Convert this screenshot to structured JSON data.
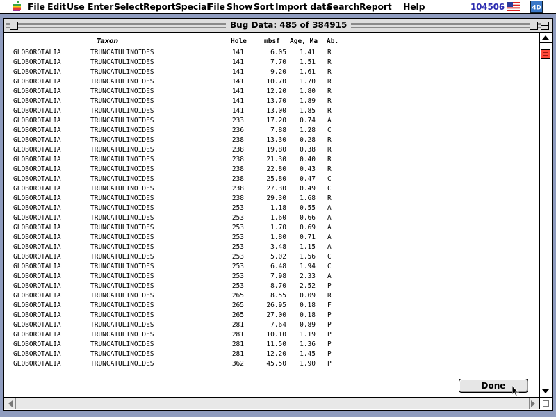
{
  "menubar": {
    "items": [
      "File",
      "Edit",
      "Use",
      "Enter",
      "Select",
      "Report",
      "Special",
      "File",
      "Show",
      "Sort",
      "Import data",
      "Search",
      "Report",
      "Help"
    ],
    "user_id": "104506",
    "icons": [
      "apple-icon",
      "flag-icon",
      "app-icon"
    ]
  },
  "window": {
    "title": "Bug Data: 485 of 384915"
  },
  "table": {
    "headers": {
      "taxon": "Taxon",
      "hole": "Hole",
      "mbsf": "mbsf",
      "age": "Age, Ma",
      "ab": "Ab."
    },
    "rows": [
      {
        "genus": "GLOBOROTALIA",
        "species": "TRUNCATULINOIDES",
        "hole": "141",
        "mbsf": "6.05",
        "age": "1.41",
        "ab": "R"
      },
      {
        "genus": "GLOBOROTALIA",
        "species": "TRUNCATULINOIDES",
        "hole": "141",
        "mbsf": "7.70",
        "age": "1.51",
        "ab": "R"
      },
      {
        "genus": "GLOBOROTALIA",
        "species": "TRUNCATULINOIDES",
        "hole": "141",
        "mbsf": "9.20",
        "age": "1.61",
        "ab": "R"
      },
      {
        "genus": "GLOBOROTALIA",
        "species": "TRUNCATULINOIDES",
        "hole": "141",
        "mbsf": "10.70",
        "age": "1.70",
        "ab": "R"
      },
      {
        "genus": "GLOBOROTALIA",
        "species": "TRUNCATULINOIDES",
        "hole": "141",
        "mbsf": "12.20",
        "age": "1.80",
        "ab": "R"
      },
      {
        "genus": "GLOBOROTALIA",
        "species": "TRUNCATULINOIDES",
        "hole": "141",
        "mbsf": "13.70",
        "age": "1.89",
        "ab": "R"
      },
      {
        "genus": "GLOBOROTALIA",
        "species": "TRUNCATULINOIDES",
        "hole": "141",
        "mbsf": "13.00",
        "age": "1.85",
        "ab": "R"
      },
      {
        "genus": "GLOBOROTALIA",
        "species": "TRUNCATULINOIDES",
        "hole": "233",
        "mbsf": "17.20",
        "age": "0.74",
        "ab": "A"
      },
      {
        "genus": "GLOBOROTALIA",
        "species": "TRUNCATULINOIDES",
        "hole": "236",
        "mbsf": "7.88",
        "age": "1.28",
        "ab": "C"
      },
      {
        "genus": "GLOBOROTALIA",
        "species": "TRUNCATULINOIDES",
        "hole": "238",
        "mbsf": "13.30",
        "age": "0.28",
        "ab": "R"
      },
      {
        "genus": "GLOBOROTALIA",
        "species": "TRUNCATULINOIDES",
        "hole": "238",
        "mbsf": "19.80",
        "age": "0.38",
        "ab": "R"
      },
      {
        "genus": "GLOBOROTALIA",
        "species": "TRUNCATULINOIDES",
        "hole": "238",
        "mbsf": "21.30",
        "age": "0.40",
        "ab": "R"
      },
      {
        "genus": "GLOBOROTALIA",
        "species": "TRUNCATULINOIDES",
        "hole": "238",
        "mbsf": "22.80",
        "age": "0.43",
        "ab": "R"
      },
      {
        "genus": "GLOBOROTALIA",
        "species": "TRUNCATULINOIDES",
        "hole": "238",
        "mbsf": "25.80",
        "age": "0.47",
        "ab": "C"
      },
      {
        "genus": "GLOBOROTALIA",
        "species": "TRUNCATULINOIDES",
        "hole": "238",
        "mbsf": "27.30",
        "age": "0.49",
        "ab": "C"
      },
      {
        "genus": "GLOBOROTALIA",
        "species": "TRUNCATULINOIDES",
        "hole": "238",
        "mbsf": "29.30",
        "age": "1.68",
        "ab": "R"
      },
      {
        "genus": "GLOBOROTALIA",
        "species": "TRUNCATULINOIDES",
        "hole": "253",
        "mbsf": "1.18",
        "age": "0.55",
        "ab": "A"
      },
      {
        "genus": "GLOBOROTALIA",
        "species": "TRUNCATULINOIDES",
        "hole": "253",
        "mbsf": "1.60",
        "age": "0.66",
        "ab": "A"
      },
      {
        "genus": "GLOBOROTALIA",
        "species": "TRUNCATULINOIDES",
        "hole": "253",
        "mbsf": "1.70",
        "age": "0.69",
        "ab": "A"
      },
      {
        "genus": "GLOBOROTALIA",
        "species": "TRUNCATULINOIDES",
        "hole": "253",
        "mbsf": "1.80",
        "age": "0.71",
        "ab": "A"
      },
      {
        "genus": "GLOBOROTALIA",
        "species": "TRUNCATULINOIDES",
        "hole": "253",
        "mbsf": "3.48",
        "age": "1.15",
        "ab": "A"
      },
      {
        "genus": "GLOBOROTALIA",
        "species": "TRUNCATULINOIDES",
        "hole": "253",
        "mbsf": "5.02",
        "age": "1.56",
        "ab": "C"
      },
      {
        "genus": "GLOBOROTALIA",
        "species": "TRUNCATULINOIDES",
        "hole": "253",
        "mbsf": "6.48",
        "age": "1.94",
        "ab": "C"
      },
      {
        "genus": "GLOBOROTALIA",
        "species": "TRUNCATULINOIDES",
        "hole": "253",
        "mbsf": "7.98",
        "age": "2.33",
        "ab": "A"
      },
      {
        "genus": "GLOBOROTALIA",
        "species": "TRUNCATULINOIDES",
        "hole": "253",
        "mbsf": "8.70",
        "age": "2.52",
        "ab": "P"
      },
      {
        "genus": "GLOBOROTALIA",
        "species": "TRUNCATULINOIDES",
        "hole": "265",
        "mbsf": "8.55",
        "age": "0.09",
        "ab": "R"
      },
      {
        "genus": "GLOBOROTALIA",
        "species": "TRUNCATULINOIDES",
        "hole": "265",
        "mbsf": "26.95",
        "age": "0.18",
        "ab": "F"
      },
      {
        "genus": "GLOBOROTALIA",
        "species": "TRUNCATULINOIDES",
        "hole": "265",
        "mbsf": "27.00",
        "age": "0.18",
        "ab": "P"
      },
      {
        "genus": "GLOBOROTALIA",
        "species": "TRUNCATULINOIDES",
        "hole": "281",
        "mbsf": "7.64",
        "age": "0.89",
        "ab": "P"
      },
      {
        "genus": "GLOBOROTALIA",
        "species": "TRUNCATULINOIDES",
        "hole": "281",
        "mbsf": "10.10",
        "age": "1.19",
        "ab": "P"
      },
      {
        "genus": "GLOBOROTALIA",
        "species": "TRUNCATULINOIDES",
        "hole": "281",
        "mbsf": "11.50",
        "age": "1.36",
        "ab": "P"
      },
      {
        "genus": "GLOBOROTALIA",
        "species": "TRUNCATULINOIDES",
        "hole": "281",
        "mbsf": "12.20",
        "age": "1.45",
        "ab": "P"
      },
      {
        "genus": "GLOBOROTALIA",
        "species": "TRUNCATULINOIDES",
        "hole": "362",
        "mbsf": "45.50",
        "age": "1.90",
        "ab": "P"
      }
    ]
  },
  "buttons": {
    "done_label": "Done"
  },
  "colors": {
    "desktop": "#8f9cbf",
    "scroll_thumb": "#ff4a3a",
    "user_id": "#2b2bb0"
  }
}
